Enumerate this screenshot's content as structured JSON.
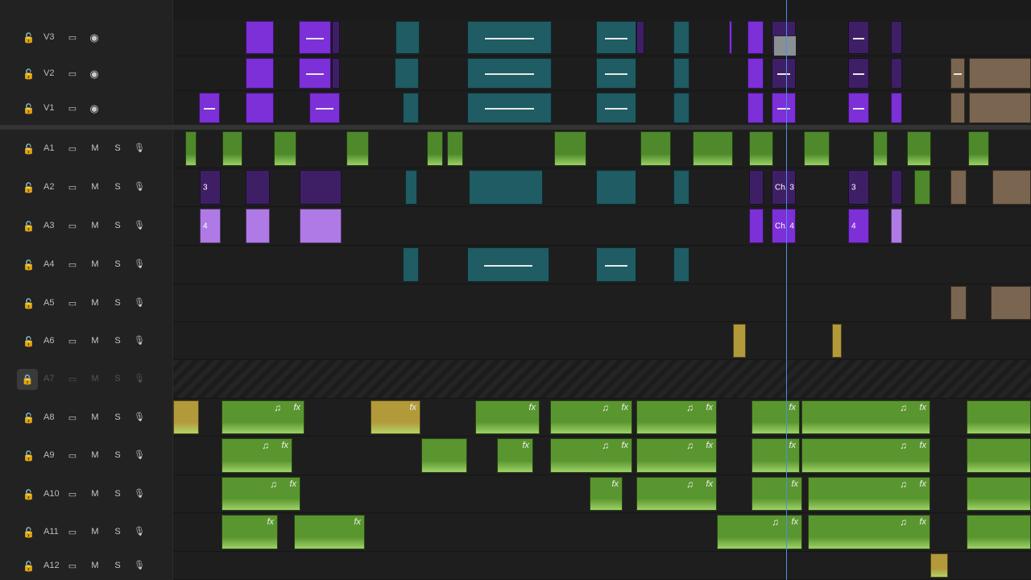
{
  "tracks": [
    {
      "name": "V3",
      "kind": "video",
      "locked": false
    },
    {
      "name": "V2",
      "kind": "video",
      "locked": false
    },
    {
      "name": "V1",
      "kind": "video",
      "locked": false
    },
    {
      "name": "A1",
      "kind": "audio",
      "locked": false
    },
    {
      "name": "A2",
      "kind": "audio",
      "locked": false
    },
    {
      "name": "A3",
      "kind": "audio",
      "locked": false
    },
    {
      "name": "A4",
      "kind": "audio",
      "locked": false
    },
    {
      "name": "A5",
      "kind": "audio",
      "locked": false
    },
    {
      "name": "A6",
      "kind": "audio",
      "locked": false
    },
    {
      "name": "A7",
      "kind": "audio",
      "locked": true
    },
    {
      "name": "A8",
      "kind": "audio",
      "locked": false
    },
    {
      "name": "A9",
      "kind": "audio",
      "locked": false
    },
    {
      "name": "A10",
      "kind": "audio",
      "locked": false
    },
    {
      "name": "A11",
      "kind": "audio",
      "locked": false
    },
    {
      "name": "A12",
      "kind": "audio",
      "locked": false
    }
  ],
  "labels": {
    "mute": "M",
    "solo": "S",
    "fx": "fx",
    "music_note": "♫",
    "marker_3": "3",
    "marker_4": "4",
    "marker_ch3": "Ch. 3",
    "marker_ch4": "Ch. 4"
  },
  "icons": {
    "lock": "lock-icon",
    "sync": "film-icon",
    "eye": "eye-icon",
    "mic": "mic-icon"
  },
  "colors": {
    "purple": "#7d2fd8",
    "teal": "#1f5c63",
    "green": "#4e8a2c",
    "gold": "#b29a3a",
    "brown": "#7a6550",
    "playhead": "#4a8ee8"
  }
}
